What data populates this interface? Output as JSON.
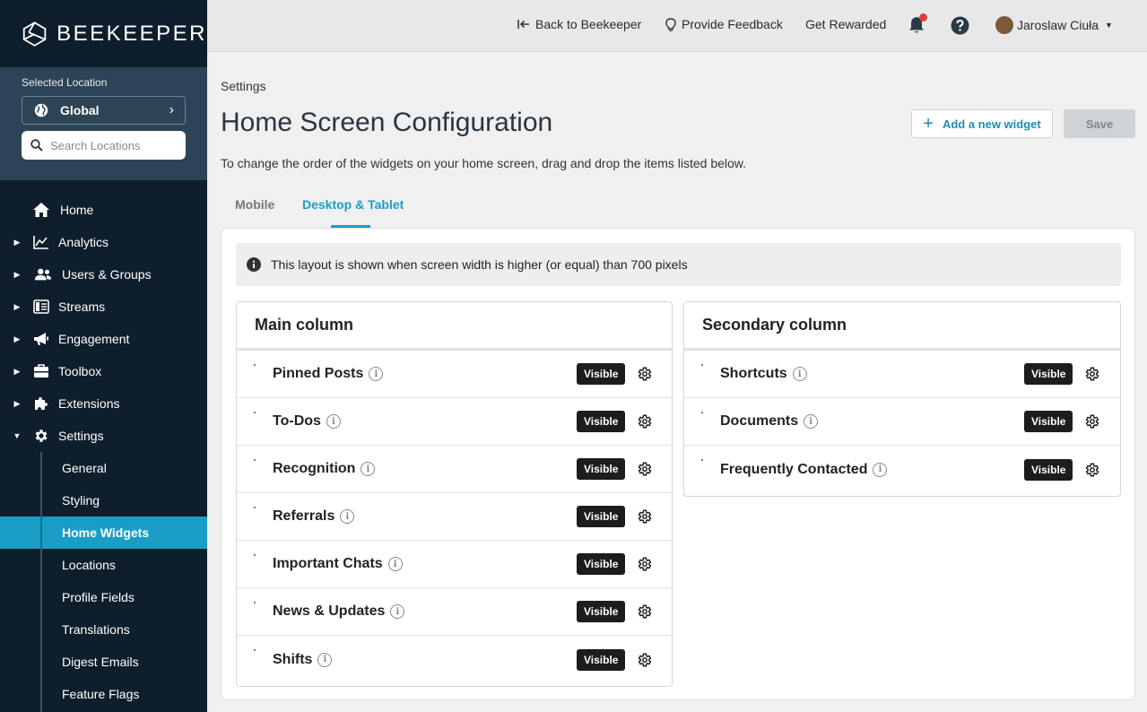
{
  "brand": {
    "name": "BEEKEEPER"
  },
  "location": {
    "label": "Selected Location",
    "value": "Global",
    "search_placeholder": "Search Locations"
  },
  "nav": {
    "home": "Home",
    "analytics": "Analytics",
    "users_groups": "Users & Groups",
    "streams": "Streams",
    "engagement": "Engagement",
    "toolbox": "Toolbox",
    "extensions": "Extensions",
    "settings": "Settings",
    "settings_sub": {
      "general": "General",
      "styling": "Styling",
      "home_widgets": "Home Widgets",
      "locations": "Locations",
      "profile_fields": "Profile Fields",
      "translations": "Translations",
      "digest_emails": "Digest Emails",
      "feature_flags": "Feature Flags"
    }
  },
  "topbar": {
    "back": "Back to Beekeeper",
    "feedback": "Provide Feedback",
    "rewarded": "Get Rewarded",
    "user": "Jaroslaw Ciuła"
  },
  "page": {
    "breadcrumb": "Settings",
    "title": "Home Screen Configuration",
    "add_widget": "Add a new widget",
    "save": "Save",
    "subtitle": "To change the order of the widgets on your home screen, drag and drop the items listed below.",
    "tabs": {
      "mobile": "Mobile",
      "desktop": "Desktop & Tablet"
    },
    "info": "This layout is shown when screen width is higher (or equal) than 700 pixels"
  },
  "main_column": {
    "title": "Main column",
    "widgets": [
      {
        "name": "Pinned Posts",
        "status": "Visible"
      },
      {
        "name": "To-Dos",
        "status": "Visible"
      },
      {
        "name": "Recognition",
        "status": "Visible"
      },
      {
        "name": "Referrals",
        "status": "Visible"
      },
      {
        "name": "Important Chats",
        "status": "Visible"
      },
      {
        "name": "News & Updates",
        "status": "Visible"
      },
      {
        "name": "Shifts",
        "status": "Visible"
      }
    ]
  },
  "secondary_column": {
    "title": "Secondary column",
    "widgets": [
      {
        "name": "Shortcuts",
        "status": "Visible"
      },
      {
        "name": "Documents",
        "status": "Visible"
      },
      {
        "name": "Frequently Contacted",
        "status": "Visible"
      }
    ]
  },
  "colors": {
    "accent": "#1a9ec6",
    "sidebar": "#0f1e2c",
    "badge": "#1d1d1d",
    "notification": "#e63a3a"
  }
}
